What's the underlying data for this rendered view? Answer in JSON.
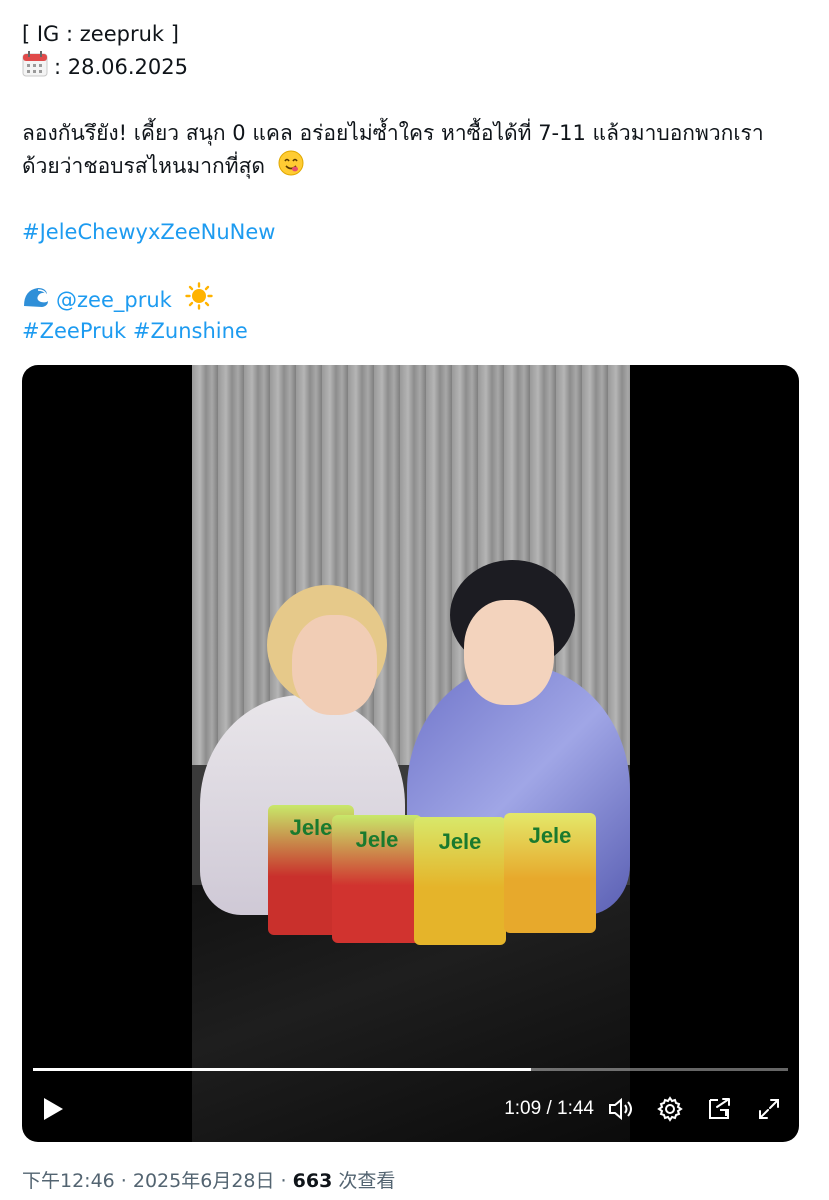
{
  "tweet": {
    "line1": "[ IG : zeepruk ]",
    "line2": ": 28.06.2025",
    "line3": "ลองกันรึยัง! เคี้ยว สนุก 0 แคล อร่อยไม่ซ้ำใคร หาซื้อได้ที่ 7-11 แล้วมาบอกพวกเรา",
    "line4": "ด้วยว่าชอบรสไหนมากที่สุด",
    "hashtag1": "#JeleChewyxZeeNuNew",
    "mention": "@zee_pruk",
    "hashtag2": "#ZeePruk",
    "hashtag3": "#Zunshine",
    "icons": [
      "calendar-icon",
      "yum-face-emoji",
      "wave-emoji",
      "sun-emoji"
    ]
  },
  "video": {
    "time_display": "1:09 / 1:44",
    "progress": 0.66,
    "packaging_text": [
      "Jele",
      "Jele",
      "Jele",
      "Jele"
    ],
    "icons": [
      "play-icon",
      "volume-icon",
      "settings-icon",
      "pip-icon",
      "fullscreen-icon"
    ]
  },
  "meta": {
    "timestamp": "下午12:46 · 2025年6月28日 · ",
    "views_count": "663",
    "views_label": " 次查看"
  },
  "colors": {
    "link": "#1d9bf0",
    "text": "#0f1419",
    "secondary": "#536471"
  }
}
